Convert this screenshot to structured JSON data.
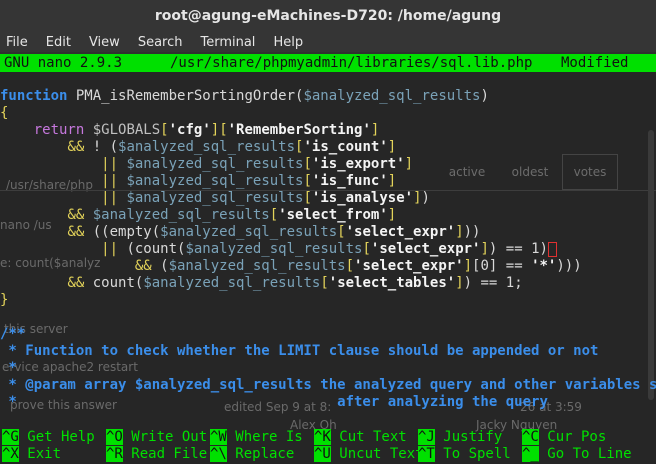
{
  "window": {
    "title": "root@agung-eMachines-D720: /home/agung"
  },
  "menu": [
    "File",
    "Edit",
    "View",
    "Search",
    "Terminal",
    "Help"
  ],
  "nano": {
    "version": "GNU nano 2.9.3",
    "path": "/usr/share/phpmyadmin/libraries/sql.lib.php",
    "status": "Modified"
  },
  "ghost": {
    "tabs": [
      "active",
      "oldest",
      "votes"
    ],
    "texts": [
      "/usr/share/php",
      "nano /us",
      "e: count($analyz",
      "this server",
      "ervice apache2 restart",
      "prove this answer",
      "edited Sep 9 at 8:",
      "Alex Oh",
      "Jacky Nguyen",
      "26 at 3:59"
    ]
  },
  "code_lines": [
    [
      [
        "kw",
        "function"
      ],
      [
        "fn",
        " PMA_isRememberSortingOrder("
      ],
      [
        "var",
        "$analyzed_sql_results"
      ],
      [
        "fn",
        ")"
      ]
    ],
    [
      [
        "brk",
        "{"
      ]
    ],
    [
      [
        "fn",
        "    "
      ],
      [
        "ret",
        "return"
      ],
      [
        "fn",
        " "
      ],
      [
        "glob",
        "$GLOBALS"
      ],
      [
        "brk",
        "["
      ],
      [
        "str",
        "'cfg'"
      ],
      [
        "brk",
        "]["
      ],
      [
        "str",
        "'RememberSorting'"
      ],
      [
        "brk",
        "]"
      ]
    ],
    [
      [
        "fn",
        "        "
      ],
      [
        "op",
        "&&"
      ],
      [
        "fn",
        " ! ("
      ],
      [
        "var",
        "$analyzed_sql_results"
      ],
      [
        "brk",
        "["
      ],
      [
        "str",
        "'is_count'"
      ],
      [
        "brk",
        "]"
      ]
    ],
    [
      [
        "fn",
        "            "
      ],
      [
        "op",
        "||"
      ],
      [
        "fn",
        " "
      ],
      [
        "var",
        "$analyzed_sql_results"
      ],
      [
        "brk",
        "["
      ],
      [
        "str",
        "'is_export'"
      ],
      [
        "brk",
        "]"
      ]
    ],
    [
      [
        "fn",
        "            "
      ],
      [
        "op",
        "||"
      ],
      [
        "fn",
        " "
      ],
      [
        "var",
        "$analyzed_sql_results"
      ],
      [
        "brk",
        "["
      ],
      [
        "str",
        "'is_func'"
      ],
      [
        "brk",
        "]"
      ]
    ],
    [
      [
        "fn",
        "            "
      ],
      [
        "op",
        "||"
      ],
      [
        "fn",
        " "
      ],
      [
        "var",
        "$analyzed_sql_results"
      ],
      [
        "brk",
        "["
      ],
      [
        "str",
        "'is_analyse'"
      ],
      [
        "brk",
        "]"
      ],
      [
        "fn",
        ")"
      ]
    ],
    [
      [
        "fn",
        "        "
      ],
      [
        "op",
        "&&"
      ],
      [
        "fn",
        " "
      ],
      [
        "var",
        "$analyzed_sql_results"
      ],
      [
        "brk",
        "["
      ],
      [
        "str",
        "'select_from'"
      ],
      [
        "brk",
        "]"
      ]
    ],
    [
      [
        "fn",
        "        "
      ],
      [
        "op",
        "&&"
      ],
      [
        "fn",
        " ((empty("
      ],
      [
        "var",
        "$analyzed_sql_results"
      ],
      [
        "brk",
        "["
      ],
      [
        "str",
        "'select_expr'"
      ],
      [
        "brk",
        "]"
      ],
      [
        "fn",
        "))"
      ]
    ],
    [
      [
        "fn",
        "            "
      ],
      [
        "op",
        "||"
      ],
      [
        "fn",
        " (count("
      ],
      [
        "var",
        "$analyzed_sql_results"
      ],
      [
        "brk",
        "["
      ],
      [
        "str",
        "'select_expr'"
      ],
      [
        "brk",
        "]"
      ],
      [
        "fn",
        ") == 1)"
      ],
      [
        "cursor",
        ""
      ]
    ],
    [
      [
        "fn",
        "                "
      ],
      [
        "op",
        "&&"
      ],
      [
        "fn",
        " ("
      ],
      [
        "var",
        "$analyzed_sql_results"
      ],
      [
        "brk",
        "["
      ],
      [
        "str",
        "'select_expr'"
      ],
      [
        "brk",
        "]"
      ],
      [
        "fn",
        "[0] == "
      ],
      [
        "str",
        "'*'"
      ],
      [
        "fn",
        ")))"
      ]
    ],
    [
      [
        "fn",
        "        "
      ],
      [
        "op",
        "&&"
      ],
      [
        "fn",
        " count("
      ],
      [
        "var",
        "$analyzed_sql_results"
      ],
      [
        "brk",
        "["
      ],
      [
        "str",
        "'select_tables'"
      ],
      [
        "brk",
        "]"
      ],
      [
        "fn",
        ") == 1;"
      ]
    ],
    [
      [
        "brk",
        "}"
      ]
    ],
    [
      [
        "fn",
        ""
      ]
    ],
    [
      [
        "cmt",
        "/**"
      ]
    ],
    [
      [
        "cmt",
        " * Function to check whether the LIMIT clause should be appended or not"
      ]
    ],
    [
      [
        "cmt",
        " *"
      ]
    ],
    [
      [
        "cmt",
        " * @param array $analyzed_sql_results the analyzed query and other variables set"
      ]
    ],
    [
      [
        "cmt",
        " *                                      after analyzing the query"
      ]
    ]
  ],
  "shortcuts": [
    {
      "key": "^G",
      "label": "Get Help"
    },
    {
      "key": "^O",
      "label": "Write Out"
    },
    {
      "key": "^W",
      "label": "Where Is"
    },
    {
      "key": "^K",
      "label": "Cut Text"
    },
    {
      "key": "^J",
      "label": "Justify"
    },
    {
      "key": "^C",
      "label": "Cur Pos"
    },
    {
      "key": "^X",
      "label": "Exit"
    },
    {
      "key": "^R",
      "label": "Read File"
    },
    {
      "key": "^\\",
      "label": "Replace"
    },
    {
      "key": "^U",
      "label": "Uncut Text"
    },
    {
      "key": "^T",
      "label": "To Spell"
    },
    {
      "key": "^_",
      "label": "Go To Line"
    }
  ],
  "colors": {
    "nano_green": "#00e000",
    "keyword_blue": "#3b8eea",
    "variable": "#7aa2b8",
    "bracket_yellow": "#e3d35a",
    "return_purple": "#c678dd"
  }
}
